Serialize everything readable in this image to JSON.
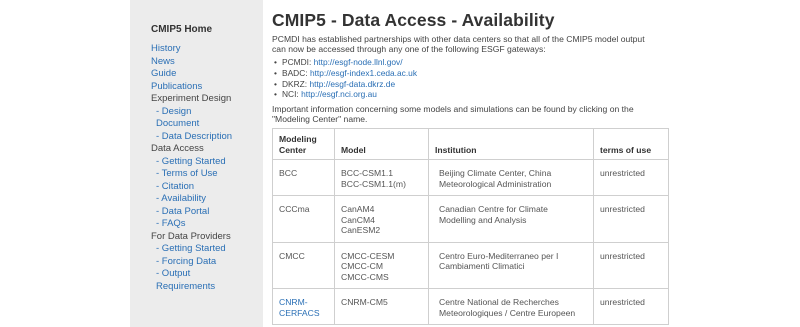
{
  "sidebar": {
    "home": "CMIP5 Home",
    "items": [
      {
        "label": "History",
        "type": "link"
      },
      {
        "label": "News",
        "type": "link"
      },
      {
        "label": "Guide",
        "type": "link"
      },
      {
        "label": "Publications",
        "type": "link"
      },
      {
        "label": "Experiment Design",
        "type": "header"
      },
      {
        "label": "- Design",
        "type": "sub"
      },
      {
        "label": "Document",
        "type": "sub"
      },
      {
        "label": "- Data Description",
        "type": "sub"
      },
      {
        "label": "Data Access",
        "type": "header"
      },
      {
        "label": "- Getting Started",
        "type": "sub"
      },
      {
        "label": "- Terms of Use",
        "type": "sub"
      },
      {
        "label": "- Citation",
        "type": "sub"
      },
      {
        "label": "- Availability",
        "type": "sub"
      },
      {
        "label": "- Data Portal",
        "type": "sub"
      },
      {
        "label": "- FAQs",
        "type": "sub"
      },
      {
        "label": "For Data Providers",
        "type": "header"
      },
      {
        "label": "- Getting Started",
        "type": "sub"
      },
      {
        "label": "- Forcing Data",
        "type": "sub"
      },
      {
        "label": "- Output",
        "type": "sub"
      },
      {
        "label": "Requirements",
        "type": "sub"
      }
    ]
  },
  "main": {
    "title": "CMIP5 - Data Access - Availability",
    "intro_lines": [
      "PCMDI has established partnerships with other data centers so that all of the CMIP5 model output",
      "can now be accessed through any one of the following ESGF gateways:"
    ],
    "gateways": [
      {
        "name": "PCMDI:",
        "url": "http://esgf-node.llnl.gov/"
      },
      {
        "name": "BADC:",
        "url": "http://esgf-index1.ceda.ac.uk"
      },
      {
        "name": "DKRZ:",
        "url": "http://esgf-data.dkrz.de"
      },
      {
        "name": "NCI:",
        "url": "http://esgf.nci.org.au"
      }
    ],
    "note_lines": [
      "Important information concerning some models and simulations can be found by clicking on the",
      "\"Modeling Center\" name."
    ]
  },
  "table": {
    "headers": [
      [
        "Modeling",
        "Center"
      ],
      [
        "Model"
      ],
      [
        "Institution"
      ],
      [
        "terms of use"
      ]
    ],
    "rows": [
      {
        "center": [
          "BCC"
        ],
        "center_link": false,
        "models": [
          "BCC-CSM1.1",
          "BCC-CSM1.1(m)"
        ],
        "institution": [
          "Beijing Climate Center, China",
          "Meteorological Administration"
        ],
        "terms": "unrestricted"
      },
      {
        "center": [
          "CCCma"
        ],
        "center_link": false,
        "models": [
          "CanAM4",
          "CanCM4",
          "CanESM2"
        ],
        "institution": [
          "Canadian Centre for Climate",
          "Modelling and Analysis"
        ],
        "terms": "unrestricted"
      },
      {
        "center": [
          "CMCC"
        ],
        "center_link": false,
        "models": [
          "CMCC-CESM",
          "CMCC-CM",
          "CMCC-CMS"
        ],
        "institution": [
          "Centro Euro-Mediterraneo per I",
          "Cambiamenti Climatici"
        ],
        "terms": "unrestricted"
      },
      {
        "center": [
          "CNRM-",
          "CERFACS"
        ],
        "center_link": true,
        "models": [
          "CNRM-CM5"
        ],
        "institution": [
          "Centre National de Recherches",
          "Meteorologiques / Centre Europeen"
        ],
        "terms": "unrestricted"
      }
    ]
  }
}
